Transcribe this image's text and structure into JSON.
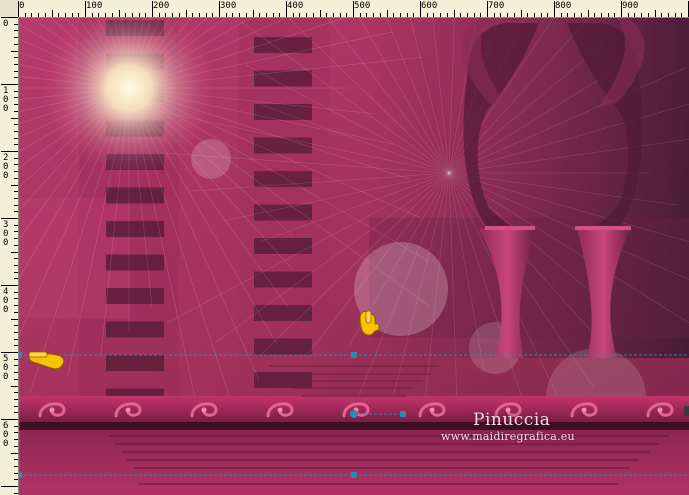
{
  "ruler": {
    "horizontal": [
      "0",
      "100",
      "200",
      "300",
      "400",
      "500",
      "600",
      "700",
      "800",
      "900"
    ],
    "vertical": [
      "0",
      "100",
      "200",
      "300",
      "400",
      "500",
      "600"
    ]
  },
  "canvas": {
    "colors": {
      "background": "#b42f63",
      "dark": "#5e1f3b",
      "guide": "#2a8ab0",
      "pointer": "#f7c300"
    }
  },
  "watermark": {
    "title": "Pinuccia",
    "url": "www.maidiregrafica.eu"
  }
}
